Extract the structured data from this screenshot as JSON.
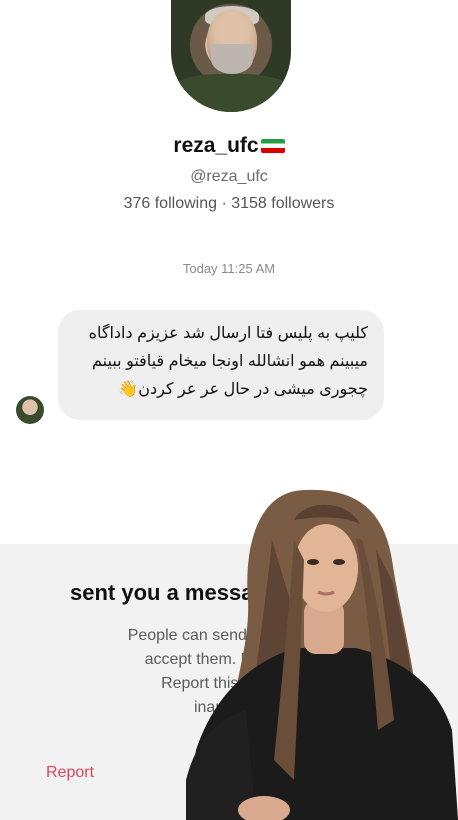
{
  "profile": {
    "username": "reza_ufc",
    "handle": "@reza_ufc",
    "stats": "376 following · 3158 followers",
    "flag_icon": "iran-flag-icon"
  },
  "conversation": {
    "timestamp": "Today 11:25 AM",
    "message_lines": [
      "کلیپ به پلیس فتا ارسال شد عزیزم داداگاه",
      "میبینم همو انشالله اونجا میخام قیافتو ببینم",
      "چجوری میشی در حال عر عر کردن"
    ],
    "message_emoji": "👋"
  },
  "request_sheet": {
    "title": "sent you a messag",
    "body_lines": [
      "People can send you up to 1 r",
      "accept them. Delete to re",
      "Report this account i",
      "inappropria"
    ],
    "report_label": "Report"
  },
  "colors": {
    "report_red": "#e0445c",
    "bubble_gray": "#efefef",
    "sheet_gray": "#f2f2f2"
  }
}
